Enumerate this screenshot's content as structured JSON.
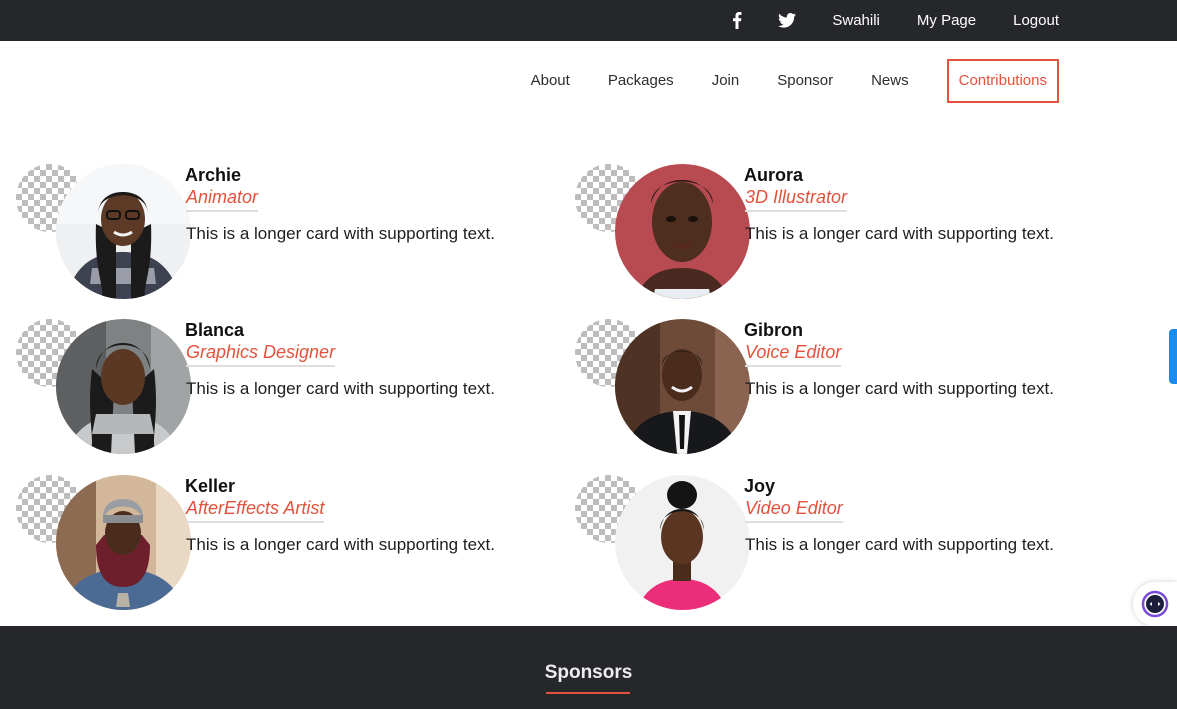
{
  "topbar": {
    "social_icons": [
      "facebook-icon",
      "twitter-icon"
    ],
    "links": [
      "Swahili",
      "My Page",
      "Logout"
    ]
  },
  "nav": {
    "items": [
      "About",
      "Packages",
      "Join",
      "Sponsor",
      "News",
      "Contributions"
    ],
    "active": "Contributions"
  },
  "cards": [
    {
      "name": "Archie",
      "role": "Animator",
      "text": "This is a longer card with supporting text."
    },
    {
      "name": "Aurora",
      "role": "3D Illustrator",
      "text": "This is a longer card with supporting text."
    },
    {
      "name": "Blanca",
      "role": "Graphics Designer",
      "text": "This is a longer card with supporting text."
    },
    {
      "name": "Gibron",
      "role": "Voice Editor",
      "text": "This is a longer card with supporting text."
    },
    {
      "name": "Keller",
      "role": "AfterEffects Artist",
      "text": "This is a longer card with supporting text."
    },
    {
      "name": "Joy",
      "role": "Video Editor",
      "text": "This is a longer card with supporting text."
    }
  ],
  "footer": {
    "title": "Sponsors"
  },
  "colors": {
    "accent": "#e2523c",
    "dark": "#26272b",
    "edge_tab": "#1a8cf0"
  }
}
